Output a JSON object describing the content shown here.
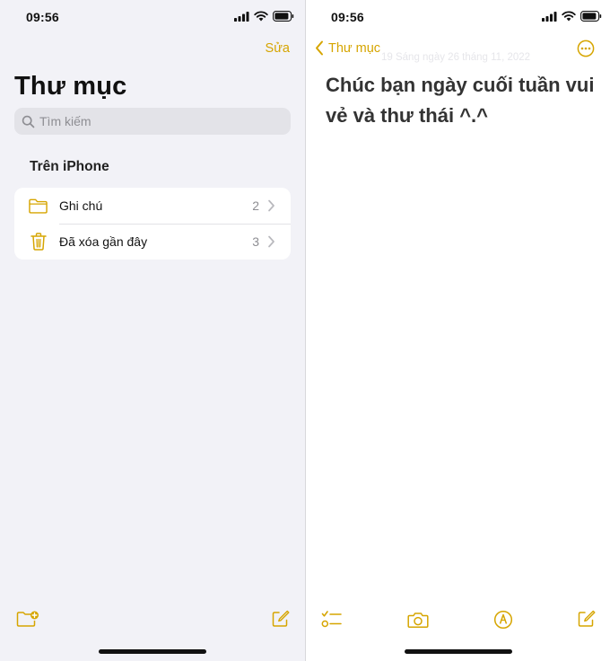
{
  "left_screen": {
    "status": {
      "time": "09:56"
    },
    "edit_label": "Sửa",
    "title": "Thư mục",
    "search": {
      "placeholder": "Tìm kiếm",
      "value": ""
    },
    "section_title": "Trên iPhone",
    "folders": [
      {
        "label": "Ghi chú",
        "count": "2",
        "icon": "folder-icon"
      },
      {
        "label": "Đã xóa gần đây",
        "count": "3",
        "icon": "trash-icon"
      }
    ],
    "toolbar": {
      "icons": [
        "new-folder-icon",
        "compose-icon"
      ]
    }
  },
  "right_screen": {
    "status": {
      "time": "09:56"
    },
    "back_label": "Thư mục",
    "date": "19 Sáng ngày 26 tháng 11, 2022",
    "note_text": "Chúc bạn ngày cuối tuần vui vẻ và thư thái ^.^",
    "toolbar": {
      "icons": [
        "checklist-icon",
        "camera-icon",
        "markup-pen-icon",
        "compose-icon"
      ]
    }
  },
  "colors": {
    "accent": "#d6a500",
    "left_background": "#f2f2f7",
    "card": "#ffffff",
    "secondary_text": "#8e8e93"
  }
}
